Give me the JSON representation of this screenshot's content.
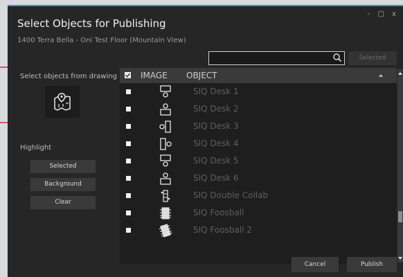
{
  "dialog": {
    "title": "Select Objects for Publishing",
    "subtitle": "1400 Terra Bella - Oni Test Floor (Mountain View)",
    "window_controls": "- □ x"
  },
  "search": {
    "value": "",
    "placeholder": "",
    "selected_button": "Selected"
  },
  "left_panel": {
    "select_label": "Select objects from drawing",
    "map_icon": "map-pin-icon",
    "highlight_label": "Highlight",
    "buttons": [
      "Selected",
      "Background",
      "Clear"
    ]
  },
  "table": {
    "columns": [
      "IMAGE",
      "OBJECT"
    ],
    "header_checked": true,
    "rows": [
      {
        "name": "SIQ Desk 1",
        "icon": "desk-down-icon"
      },
      {
        "name": "SIQ Desk 2",
        "icon": "desk-up-icon"
      },
      {
        "name": "SIQ Desk 3",
        "icon": "desk-left-icon"
      },
      {
        "name": "SIQ Desk 4",
        "icon": "desk-right-icon"
      },
      {
        "name": "SIQ Desk 5",
        "icon": "desk-down-icon"
      },
      {
        "name": "SIQ Desk 6",
        "icon": "desk-up-icon"
      },
      {
        "name": "SIQ Double Collab",
        "icon": "collab-icon"
      },
      {
        "name": "SIQ Foosball",
        "icon": "foosball-icon"
      },
      {
        "name": "SIQ Foosball 2",
        "icon": "foosball-icon"
      }
    ]
  },
  "footer": {
    "cancel": "Cancel",
    "publish": "Publish"
  },
  "colors": {
    "accent": "#22a6c8",
    "dialog_bg": "#262626",
    "row_text": "#5e5e5e"
  }
}
